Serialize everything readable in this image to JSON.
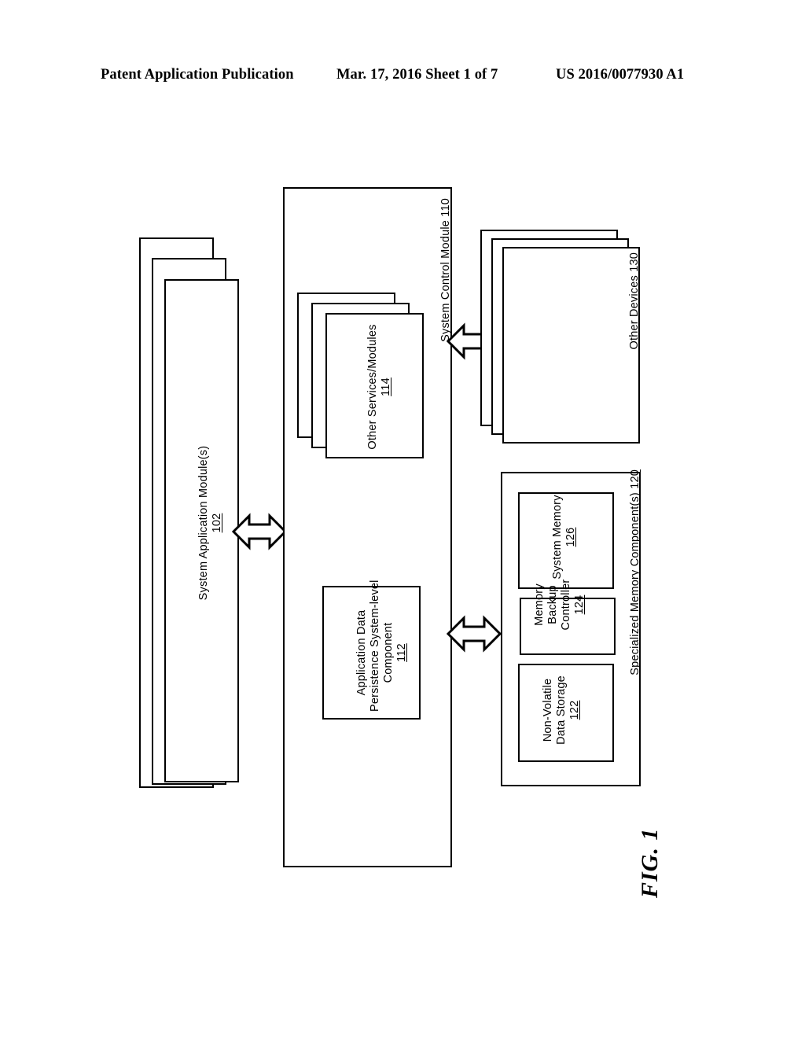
{
  "page_header": {
    "left": "Patent Application Publication",
    "middle": "Mar. 17, 2016  Sheet 1 of 7",
    "right": "US 2016/0077930 A1"
  },
  "figure": {
    "caption": "FIG. 1",
    "blocks": {
      "system_application_modules": {
        "label": "System Application Module(s)",
        "ref": "102",
        "stack_count": 3
      },
      "system_control_module": {
        "label": "System Control Module",
        "ref": "110"
      },
      "other_services_modules": {
        "label": "Other Services/Modules",
        "ref": "114",
        "stack_count": 3
      },
      "application_data_persistence": {
        "line1": "Application Data",
        "line2": "Persistence System-level",
        "line3": "Component",
        "ref": "112"
      },
      "other_devices": {
        "label": "Other Devices",
        "ref": "130",
        "stack_count": 3
      },
      "specialized_memory_components": {
        "label": "Specialized Memory Component(s)",
        "ref": "120"
      },
      "system_memory": {
        "label": "System Memory",
        "ref": "126"
      },
      "memory_backup_controller": {
        "line1": "Memory",
        "line2": "Backup",
        "line3": "Controller",
        "ref": "124"
      },
      "non_volatile_data_storage": {
        "line1": "Non-Volatile",
        "line2": "Data Storage",
        "ref": "122"
      }
    },
    "connectors": [
      {
        "name": "apps-to-control",
        "type": "bidirectional-arrow"
      },
      {
        "name": "control-to-other-devices",
        "type": "bidirectional-arrow"
      },
      {
        "name": "control-to-memory",
        "type": "bidirectional-arrow"
      }
    ]
  },
  "colors": {
    "ink": "#000000",
    "paper": "#ffffff"
  }
}
